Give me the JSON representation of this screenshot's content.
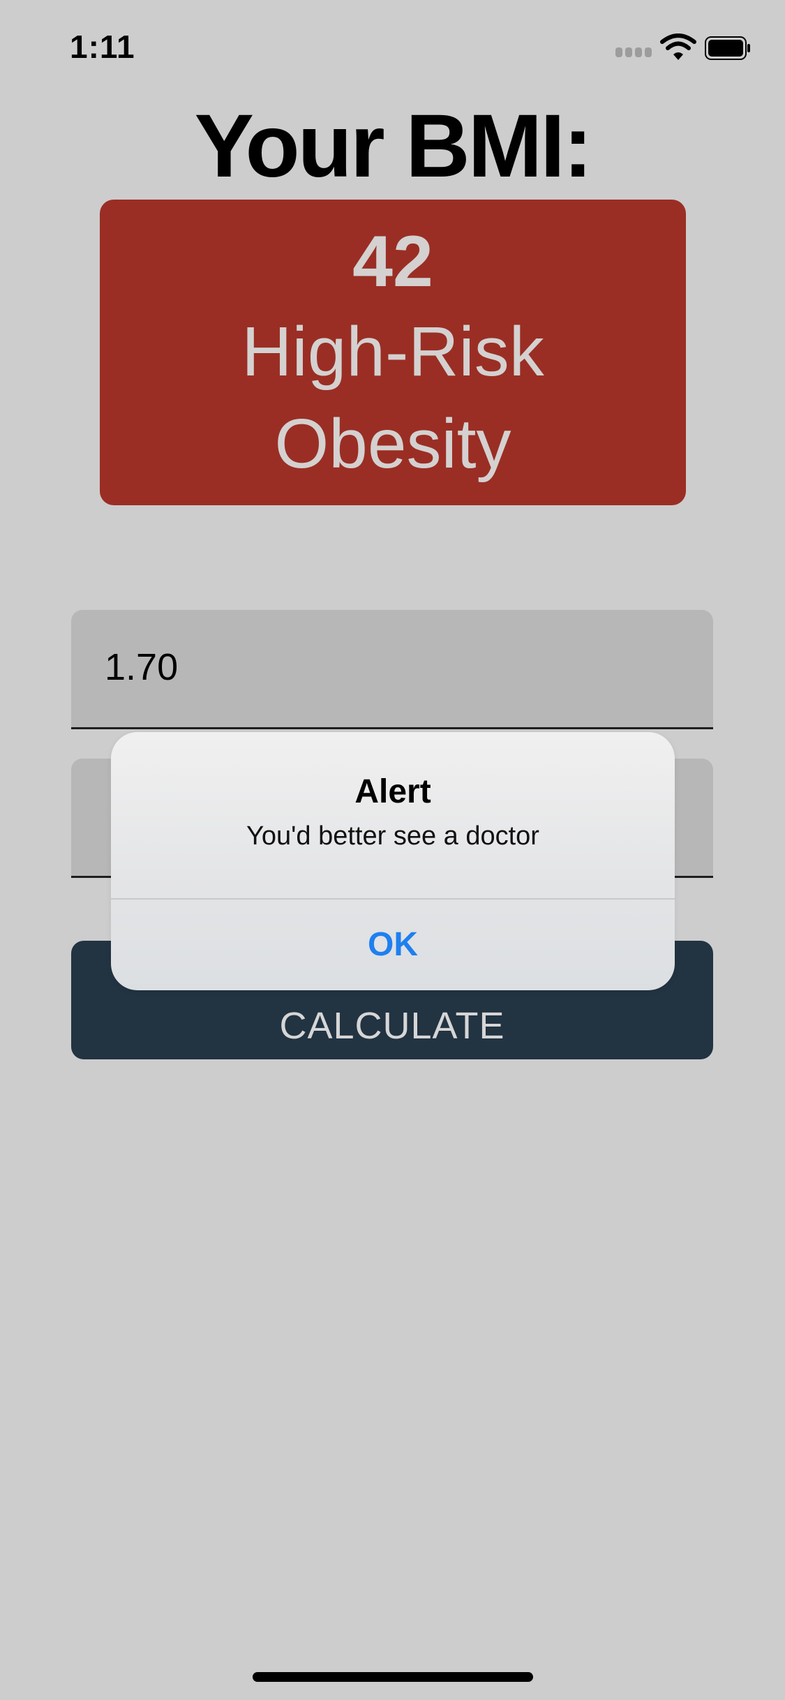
{
  "status_bar": {
    "time": "1:11",
    "icons": [
      "signal-icon",
      "wifi-icon",
      "battery-icon"
    ]
  },
  "title": "Your BMI:",
  "result": {
    "value": "42",
    "category": "High-Risk Obesity",
    "background_color": "#9a2e24"
  },
  "inputs": {
    "height_value": "1.70",
    "weight_value": ""
  },
  "calculate_button": {
    "label": "CALCULATE",
    "background_color": "#223342"
  },
  "alert": {
    "title": "Alert",
    "message": "You'd better see a doctor",
    "ok_label": "OK",
    "ok_color": "#1f7ff0"
  },
  "colors": {
    "background": "#cdcdcd",
    "field_background": "#b7b7b7"
  }
}
